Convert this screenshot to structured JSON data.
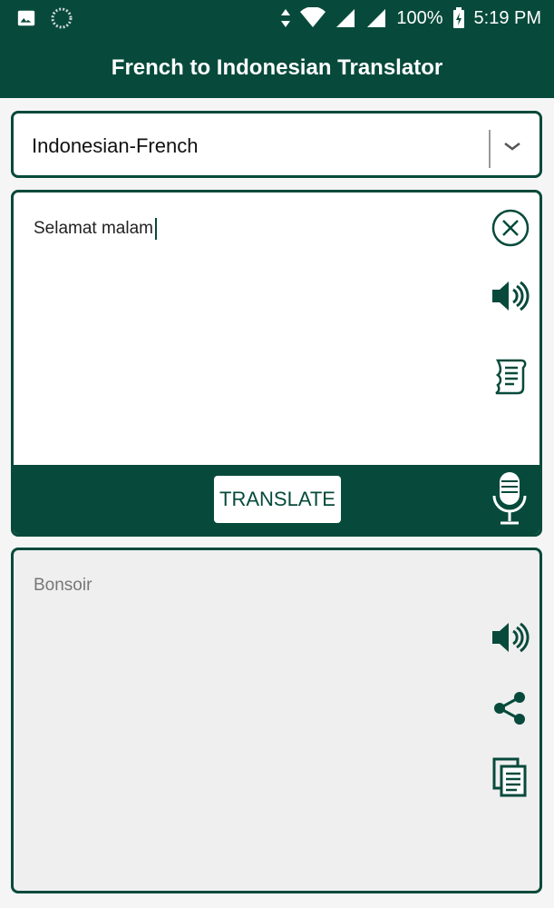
{
  "status_bar": {
    "battery": "100%",
    "time": "5:19 PM"
  },
  "app_bar": {
    "title": "French to Indonesian Translator"
  },
  "language_select": {
    "value": "Indonesian-French"
  },
  "input": {
    "text": "Selamat malam"
  },
  "actions": {
    "translate_label": "TRANSLATE"
  },
  "output": {
    "text": "Bonsoir"
  },
  "colors": {
    "primary": "#074a3b",
    "surface": "#ffffff",
    "output_bg": "#efefef"
  },
  "icons": [
    "image-icon",
    "sync-icon",
    "arrows-icon",
    "wifi-icon",
    "signal-icon",
    "battery-icon",
    "chevron-down-icon",
    "clear-icon",
    "speaker-icon",
    "scroll-icon",
    "mic-icon",
    "share-icon",
    "copy-icon"
  ]
}
